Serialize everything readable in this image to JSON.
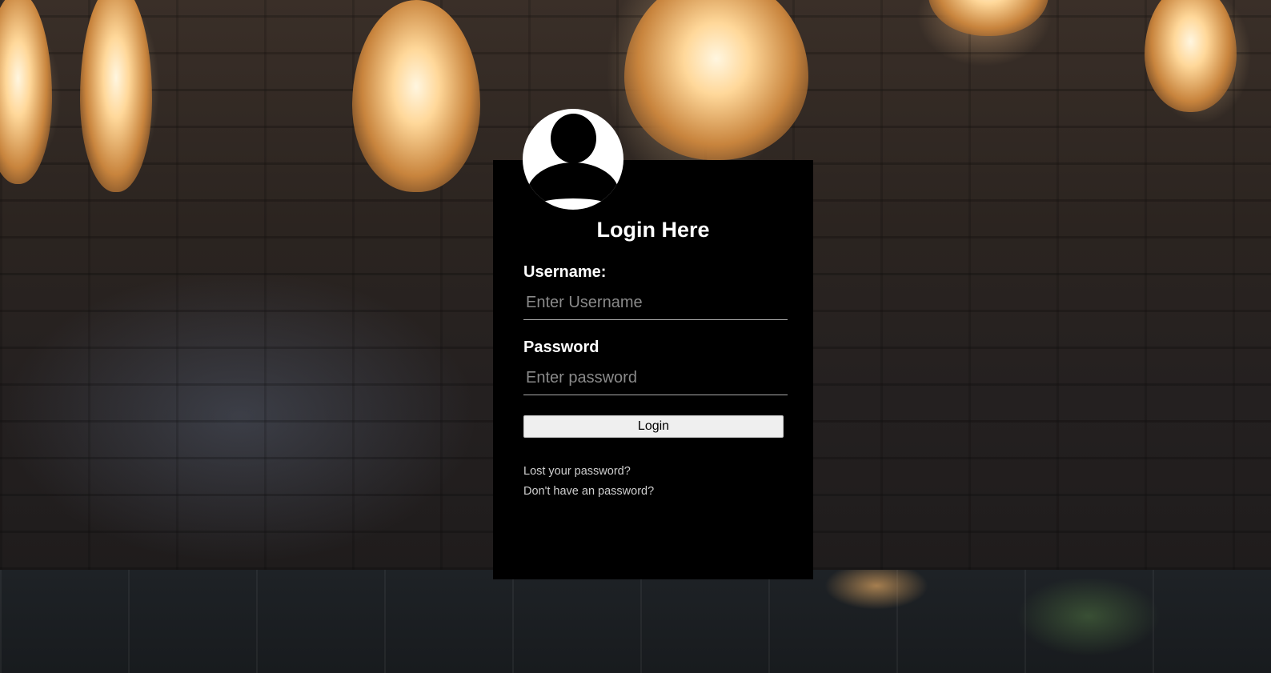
{
  "login_form": {
    "title": "Login Here",
    "username": {
      "label": "Username:",
      "placeholder": "Enter Username",
      "value": ""
    },
    "password": {
      "label": "Password",
      "placeholder": "Enter password",
      "value": ""
    },
    "submit_label": "Login",
    "links": {
      "lost_password": "Lost your password?",
      "no_password": "Don't have an password?"
    }
  },
  "avatar_icon": "user-silhouette-icon",
  "colors": {
    "panel_background": "#000000",
    "text": "#ffffff",
    "placeholder": "#8a8a8a",
    "button_background": "#efefef",
    "link": "#cfcfcf"
  }
}
